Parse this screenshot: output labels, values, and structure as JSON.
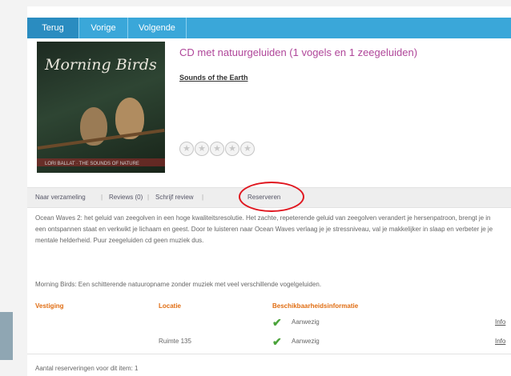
{
  "nav": {
    "back_label": "Terug",
    "prev_label": "Vorige",
    "next_label": "Volgende"
  },
  "item": {
    "title": "CD met natuurgeluiden (1 vogels en 1 zeegeluiden)",
    "author": "Sounds of the Earth",
    "cover_title": "Morning Birds",
    "cover_footer": "LORI BALLAT · THE SOUNDS OF NATURE",
    "rating_stars": 5,
    "rating_value": 0
  },
  "tabs": {
    "collection": "Naar verzameling",
    "reviews": "Reviews (0)",
    "write_review": "Schrijf review",
    "reserve": "Reserveren"
  },
  "description": {
    "paragraph1": "Ocean Waves 2: het geluid van zeegolven in een hoge kwaliteitsresolutie. Het zachte, repeterende geluid van zeegolven verandert je hersenpatroon, brengt je in een ontspannen staat en verkwikt je lichaam en geest. Door te luisteren naar Ocean Waves verlaag je je stressniveau, val je makkelijker in slaap en verbeter je je mentale helderheid. Puur zeegeluiden cd geen muziek dus.",
    "paragraph2": "Morning Birds: Een schitterende natuuropname zonder muziek met veel verschillende vogelgeluiden."
  },
  "availability": {
    "headers": {
      "branch": "Vestiging",
      "location": "Locatie",
      "status": "Beschikbaarheidsinformatie"
    },
    "rows": [
      {
        "location": "",
        "status": "Aanwezig",
        "info": "Info"
      },
      {
        "location": "Ruimte 135",
        "status": "Aanwezig",
        "info": "Info"
      }
    ],
    "reservations_count_text": "Aantal reserveringen voor dit item: 1"
  },
  "colors": {
    "nav_blue": "#3aa7d9",
    "title_purple": "#b0479a",
    "header_orange": "#e06d12",
    "check_green": "#4aa33a",
    "circle_red": "#e0161f"
  }
}
